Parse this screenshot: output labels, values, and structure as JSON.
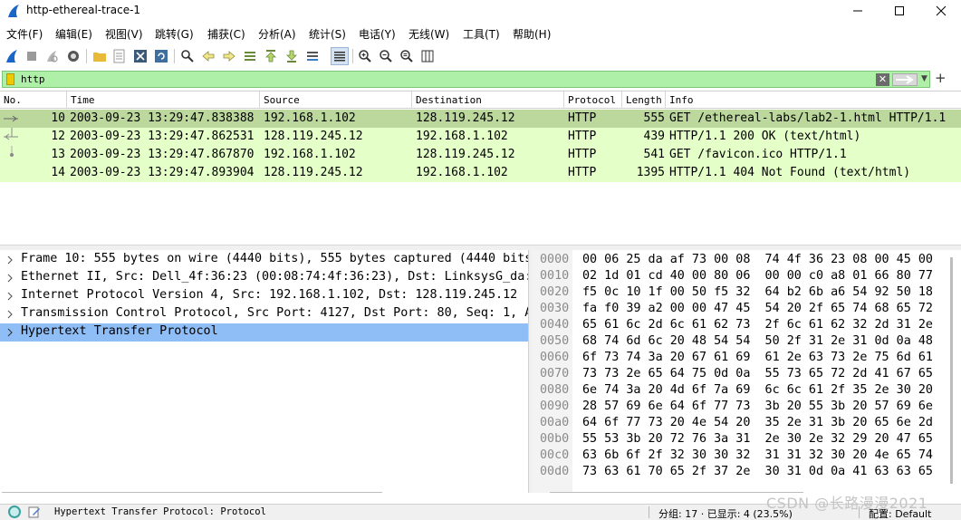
{
  "window": {
    "title": "http-ethereal-trace-1"
  },
  "menu": [
    "文件(F)",
    "编辑(E)",
    "视图(V)",
    "跳转(G)",
    "捕获(C)",
    "分析(A)",
    "统计(S)",
    "电话(Y)",
    "无线(W)",
    "工具(T)",
    "帮助(H)"
  ],
  "toolbar": {
    "icons": [
      "shark-start-icon",
      "stop-icon",
      "restart-icon",
      "options-icon",
      "open-file-icon",
      "save-file-icon",
      "close-file-icon",
      "reload-icon",
      "find-icon",
      "back-icon",
      "forward-icon",
      "goto-packet-icon",
      "first-packet-icon",
      "last-packet-icon",
      "autoscroll-icon",
      "colorize-icon",
      "zoom-in-icon",
      "zoom-out-icon",
      "normal-size-icon",
      "resize-columns-icon"
    ]
  },
  "filter": {
    "value": "http"
  },
  "packet_list": {
    "columns": [
      "No.",
      "Time",
      "Source",
      "Destination",
      "Protocol",
      "Length",
      "Info"
    ],
    "rows": [
      {
        "no": "10",
        "time": "2003-09-23 13:29:47.838388",
        "src": "192.168.1.102",
        "dst": "128.119.245.12",
        "proto": "HTTP",
        "len": "555",
        "info": "GET /ethereal-labs/lab2-1.html HTTP/1.1",
        "selected": true
      },
      {
        "no": "12",
        "time": "2003-09-23 13:29:47.862531",
        "src": "128.119.245.12",
        "dst": "192.168.1.102",
        "proto": "HTTP",
        "len": "439",
        "info": "HTTP/1.1 200 OK  (text/html)",
        "selected": false
      },
      {
        "no": "13",
        "time": "2003-09-23 13:29:47.867870",
        "src": "192.168.1.102",
        "dst": "128.119.245.12",
        "proto": "HTTP",
        "len": "541",
        "info": "GET /favicon.ico HTTP/1.1",
        "selected": false
      },
      {
        "no": "14",
        "time": "2003-09-23 13:29:47.893904",
        "src": "128.119.245.12",
        "dst": "192.168.1.102",
        "proto": "HTTP",
        "len": "1395",
        "info": "HTTP/1.1 404 Not Found  (text/html)",
        "selected": false
      }
    ]
  },
  "details": [
    "Frame 10: 555 bytes on wire (4440 bits), 555 bytes captured (4440 bits",
    "Ethernet II, Src: Dell_4f:36:23 (00:08:74:4f:36:23), Dst: LinksysG_da:",
    "Internet Protocol Version 4, Src: 192.168.1.102, Dst: 128.119.245.12",
    "Transmission Control Protocol, Src Port: 4127, Dst Port: 80, Seq: 1, A",
    "Hypertext Transfer Protocol"
  ],
  "details_selected_index": 4,
  "hex": [
    {
      "off": "0000",
      "bytes": "00 06 25 da af 73 00 08  74 4f 36 23 08 00 45 00"
    },
    {
      "off": "0010",
      "bytes": "02 1d 01 cd 40 00 80 06  00 00 c0 a8 01 66 80 77"
    },
    {
      "off": "0020",
      "bytes": "f5 0c 10 1f 00 50 f5 32  64 b2 6b a6 54 92 50 18"
    },
    {
      "off": "0030",
      "bytes": "fa f0 39 a2 00 00 47 45  54 20 2f 65 74 68 65 72"
    },
    {
      "off": "0040",
      "bytes": "65 61 6c 2d 6c 61 62 73  2f 6c 61 62 32 2d 31 2e"
    },
    {
      "off": "0050",
      "bytes": "68 74 6d 6c 20 48 54 54  50 2f 31 2e 31 0d 0a 48"
    },
    {
      "off": "0060",
      "bytes": "6f 73 74 3a 20 67 61 69  61 2e 63 73 2e 75 6d 61"
    },
    {
      "off": "0070",
      "bytes": "73 73 2e 65 64 75 0d 0a  55 73 65 72 2d 41 67 65"
    },
    {
      "off": "0080",
      "bytes": "6e 74 3a 20 4d 6f 7a 69  6c 6c 61 2f 35 2e 30 20"
    },
    {
      "off": "0090",
      "bytes": "28 57 69 6e 64 6f 77 73  3b 20 55 3b 20 57 69 6e"
    },
    {
      "off": "00a0",
      "bytes": "64 6f 77 73 20 4e 54 20  35 2e 31 3b 20 65 6e 2d"
    },
    {
      "off": "00b0",
      "bytes": "55 53 3b 20 72 76 3a 31  2e 30 2e 32 29 20 47 65"
    },
    {
      "off": "00c0",
      "bytes": "63 6b 6f 2f 32 30 30 32  31 31 32 30 20 4e 65 74"
    },
    {
      "off": "00d0",
      "bytes": "73 63 61 70 65 2f 37 2e  30 31 0d 0a 41 63 63 65"
    }
  ],
  "status": {
    "field": "Hypertext Transfer Protocol: Protocol",
    "packets": "分组: 17 · 已显示: 4 (23.5%)",
    "profile": "配置: Default"
  },
  "watermark": "CSDN @长路漫漫2021",
  "colors": {
    "filter_bg": "#aff0a8",
    "row_bg": "#e4ffc7",
    "row_selected": "#bcd89d",
    "detail_selected": "#8fbdf5"
  }
}
